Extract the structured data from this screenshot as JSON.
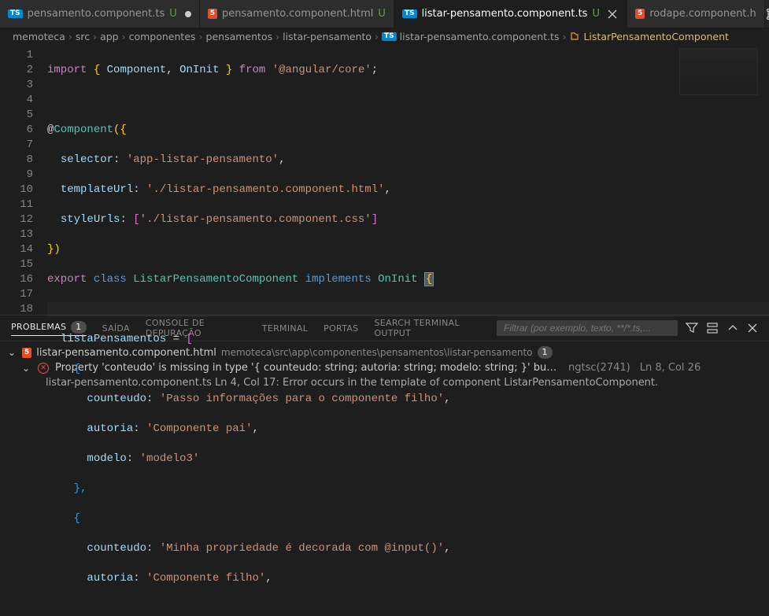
{
  "tabs": [
    {
      "icon": "ts",
      "label": "pensamento.component.ts",
      "dirty": "U",
      "modified": true
    },
    {
      "icon": "html",
      "label": "pensamento.component.html",
      "dirty": "U"
    },
    {
      "icon": "ts",
      "label": "listar-pensamento.component.ts",
      "dirty": "U",
      "active": true,
      "closeable": true
    },
    {
      "icon": "html",
      "label": "rodape.component.h"
    }
  ],
  "breadcrumb": {
    "parts": [
      "memoteca",
      "src",
      "app",
      "componentes",
      "pensamentos",
      "listar-pensamento"
    ],
    "file": "listar-pensamento.component.ts",
    "symbol": "ListarPensamentoComponent"
  },
  "panel": {
    "tabs": {
      "problemas": "PROBLEMAS",
      "saida": "SAÍDA",
      "console": "CONSOLE DE DEPURAÇÃO",
      "terminal": "TERMINAL",
      "portas": "PORTAS",
      "search": "SEARCH TERMINAL OUTPUT"
    },
    "problem_count": "1",
    "filter_placeholder": "Filtrar (por exemplo, texto, **/*.ts,...",
    "file": {
      "name": "listar-pensamento.component.html",
      "path": "memoteca\\src\\app\\componentes\\pensamentos\\listar-pensamento",
      "count": "1"
    },
    "error": {
      "msg": "Property 'conteudo' is missing in type '{ counteudo: string; autoria: string; modelo: string; }' but required in type '{ conteudo: stri...",
      "code": "ngtsc(2741)",
      "loc": "Ln 8, Col 26"
    },
    "sub": {
      "path": "listar-pensamento.component.ts",
      "loc": "Ln 4, Col 17:",
      "msg": "Error occurs in the template of component ListarPensamentoComponent."
    }
  },
  "code": {
    "l1_import": "import",
    "l1_brace_o": "{ ",
    "l1_comp": "Component",
    "l1_comma": ", ",
    "l1_oninit": "OnInit",
    "l1_brace_c": " }",
    "l1_from": " from ",
    "l1_mod": "'@angular/core'",
    "l1_semi": ";",
    "l3_at": "@",
    "l3_comp": "Component",
    "l3_p": "({",
    "l4_k": "selector",
    "l4_v": "'app-listar-pensamento'",
    "l4_c": ",",
    "l5_k": "templateUrl",
    "l5_v": "'./listar-pensamento.component.html'",
    "l5_c": ",",
    "l6_k": "styleUrls",
    "l6_b": "[",
    "l6_v": "'./listar-pensamento.component.css'",
    "l6_e": "]",
    "l7": "})",
    "l8_export": "export",
    "l8_class": "class",
    "l8_name": "ListarPensamentoComponent",
    "l8_impl": "implements",
    "l8_on": "OnInit",
    "l8_br": "{",
    "l10_k": "listaPensamentos",
    "l10_eq": " = ",
    "l10_b": "[",
    "l11": "{",
    "l12_k": "counteudo",
    "l12_v": "'Passo informações para o componente filho'",
    "l12_c": ",",
    "l13_k": "autoria",
    "l13_v": "'Componente pai'",
    "l13_c": ",",
    "l14_k": "modelo",
    "l14_v": "'modelo3'",
    "l15": "},",
    "l16": "{",
    "l17_k": "counteudo",
    "l17_v": "'Minha propriedade é decorada com @input()'",
    "l17_c": ",",
    "l18_k": "autoria",
    "l18_v": "'Componente filho'",
    "l18_c": ","
  },
  "lines": [
    "1",
    "2",
    "3",
    "4",
    "5",
    "6",
    "7",
    "8",
    "9",
    "10",
    "11",
    "12",
    "13",
    "14",
    "15",
    "16",
    "17",
    "18"
  ]
}
